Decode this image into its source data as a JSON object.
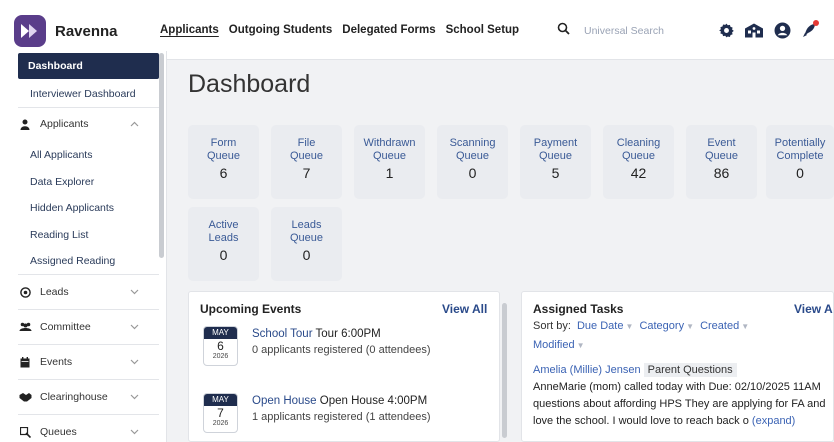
{
  "app": {
    "name": "Ravenna"
  },
  "nav": {
    "items": [
      "Applicants",
      "Outgoing Students",
      "Delegated Forms",
      "School Setup"
    ]
  },
  "search": {
    "placeholder": "Universal Search"
  },
  "sidebar": {
    "dashboard": "Dashboard",
    "interviewer": "Interviewer Dashboard",
    "applicants": "Applicants",
    "all_applicants": "All Applicants",
    "data_explorer": "Data Explorer",
    "hidden_applicants": "Hidden Applicants",
    "reading_list": "Reading List",
    "assigned_reading": "Assigned Reading",
    "leads": "Leads",
    "committee": "Committee",
    "events": "Events",
    "clearinghouse": "Clearinghouse",
    "queues": "Queues"
  },
  "page": {
    "title": "Dashboard"
  },
  "tiles": [
    {
      "l1": "Form",
      "l2": "Queue",
      "value": "6"
    },
    {
      "l1": "File",
      "l2": "Queue",
      "value": "7"
    },
    {
      "l1": "Withdrawn",
      "l2": "Queue",
      "value": "1"
    },
    {
      "l1": "Scanning",
      "l2": "Queue",
      "value": "0"
    },
    {
      "l1": "Payment",
      "l2": "Queue",
      "value": "5"
    },
    {
      "l1": "Cleaning",
      "l2": "Queue",
      "value": "42"
    },
    {
      "l1": "Event",
      "l2": "Queue",
      "value": "86"
    },
    {
      "l1": "Potentially",
      "l2": "Complete",
      "value": "0"
    },
    {
      "l1": "Active",
      "l2": "Leads",
      "value": "0"
    },
    {
      "l1": "Leads",
      "l2": "Queue",
      "value": "0"
    }
  ],
  "events_panel": {
    "title": "Upcoming Events",
    "view_all": "View All",
    "events": [
      {
        "month": "MAY",
        "day": "6",
        "year": "2026",
        "name": "School Tour",
        "detail": "Tour 6:00PM",
        "registered": "0 applicants registered (0 attendees)"
      },
      {
        "month": "MAY",
        "day": "7",
        "year": "2026",
        "name": "Open House",
        "detail": "Open House 4:00PM",
        "registered": "1 applicants registered (1 attendees)"
      }
    ]
  },
  "tasks_panel": {
    "title": "Assigned Tasks",
    "view_all": "View A",
    "sort_label": "Sort by:",
    "sort_options": [
      "Due Date",
      "Category",
      "Created",
      "Modified"
    ],
    "task": {
      "who": "Amelia (Millie) Jensen",
      "category": "Parent Questions",
      "text1": "AnneMarie (mom) called today with",
      "due": "Due: 02/10/2025 11AM",
      "text2": "questions about affording HPS They are applying for FA and",
      "text3": "love the school. I would love to reach back o",
      "expand": "(expand)"
    }
  },
  "colors": {
    "navy": "#1f2d4e",
    "link": "#3b63b4",
    "brand": "#5a3d8a",
    "notification": "#e53935"
  }
}
